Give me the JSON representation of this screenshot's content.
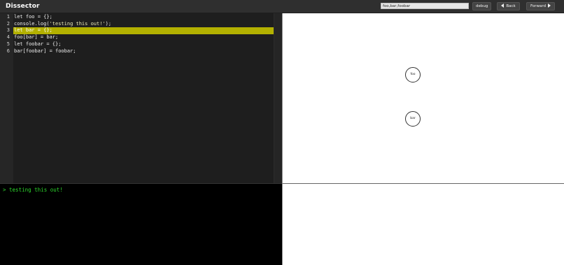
{
  "header": {
    "title": "Dissector",
    "vars_input_value": "foo,bar,foobar",
    "debug_label": "debug",
    "back_label": "Back",
    "forward_label": "Forward"
  },
  "editor": {
    "lines": [
      {
        "number": "1",
        "code": "let foo = {};"
      },
      {
        "number": "2",
        "code_pre": "console.log(",
        "code_str": "'testing this out!'",
        "code_post": ");"
      },
      {
        "number": "3",
        "code": "let bar = {};"
      },
      {
        "number": "4",
        "code": "foo[bar] = bar;"
      },
      {
        "number": "5",
        "code": "let foobar = {};"
      },
      {
        "number": "6",
        "code": "bar[foobar] = foobar;"
      }
    ],
    "active_line": 3,
    "highlight_color": "#b3b100"
  },
  "visualization": {
    "nodes": [
      {
        "label": "foo"
      },
      {
        "label": "bar"
      }
    ]
  },
  "console": {
    "output": "> testing this out!",
    "text_color": "#2cd62c"
  }
}
